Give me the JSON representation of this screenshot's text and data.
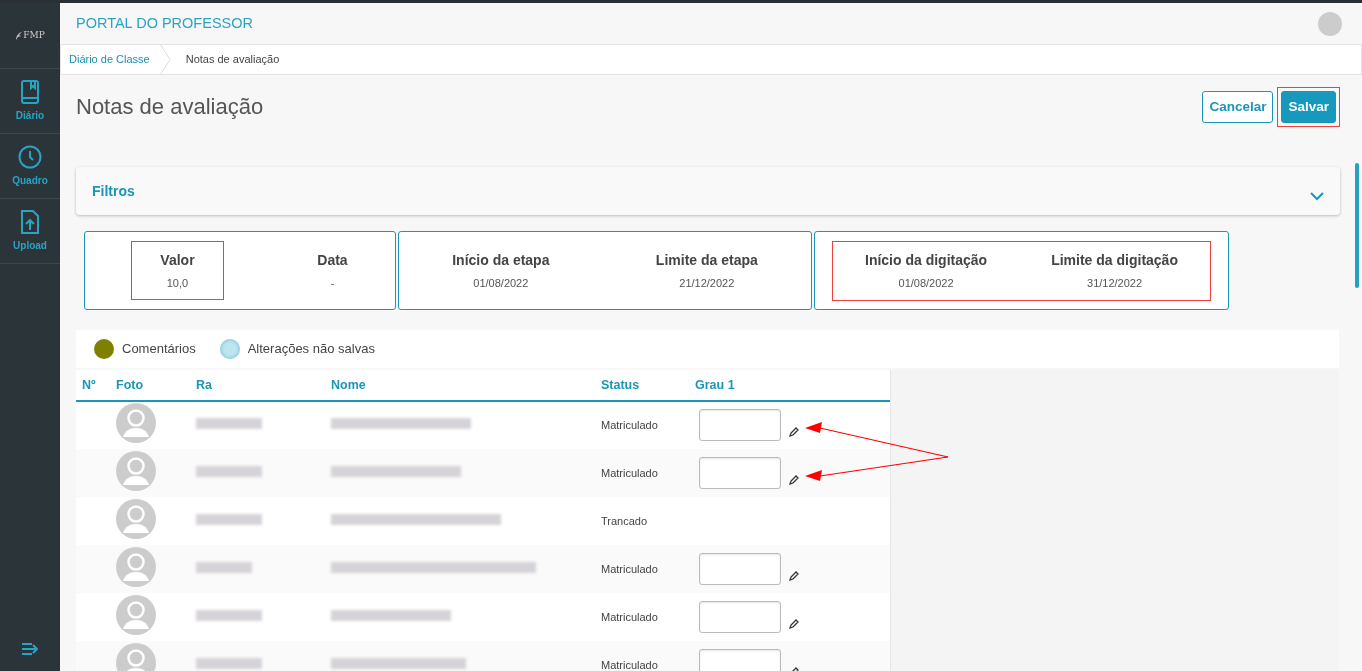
{
  "sidebar": {
    "logo": "FMP",
    "items": [
      {
        "label": "Diário"
      },
      {
        "label": "Quadro"
      },
      {
        "label": "Upload"
      }
    ]
  },
  "header": {
    "title": "PORTAL DO PROFESSOR"
  },
  "breadcrumb": [
    {
      "label": "Diário de Classe",
      "link": true
    },
    {
      "label": "Notas de avaliação",
      "link": false
    }
  ],
  "page": {
    "title": "Notas de avaliação",
    "buttons": [
      {
        "label": "Cancelar",
        "kind": "outline",
        "highlighted": false
      },
      {
        "label": "Salvar",
        "kind": "primary",
        "highlighted": true
      }
    ]
  },
  "filters": {
    "title": "Filtros",
    "expanded": false
  },
  "info_cards": [
    {
      "highlighted": false,
      "items": [
        {
          "label": "Valor",
          "value": "10,0",
          "highlighted": true
        },
        {
          "label": "Data",
          "value": "-",
          "highlighted": false
        }
      ]
    },
    {
      "highlighted": false,
      "items": [
        {
          "label": "Início da etapa",
          "value": "01/08/2022",
          "highlighted": false
        },
        {
          "label": "Limite da etapa",
          "value": "21/12/2022",
          "highlighted": false
        }
      ]
    },
    {
      "highlighted": true,
      "items": [
        {
          "label": "Início da digitação",
          "value": "01/08/2022",
          "highlighted": false
        },
        {
          "label": "Limite da digitação",
          "value": "31/12/2022",
          "highlighted": false
        }
      ]
    }
  ],
  "legend": [
    {
      "label": "Comentários",
      "color": "#808000"
    },
    {
      "label": "Alterações não salvas",
      "color": "#bfe6f0"
    }
  ],
  "table": {
    "columns": [
      "Nº",
      "Foto",
      "Ra",
      "Nome",
      "Status",
      "Grau 1"
    ],
    "rows": [
      {
        "status": "Matriculado",
        "kind": "grade",
        "pointed": true
      },
      {
        "status": "Matriculado",
        "kind": "grade",
        "pointed": true
      },
      {
        "status": "Trancado",
        "kind": "locked",
        "pointed": false
      },
      {
        "status": "Matriculado",
        "kind": "grade",
        "pointed": false
      },
      {
        "status": "Matriculado",
        "kind": "grade",
        "pointed": false
      },
      {
        "status": "Matriculado",
        "kind": "grade",
        "pointed": false
      }
    ]
  }
}
